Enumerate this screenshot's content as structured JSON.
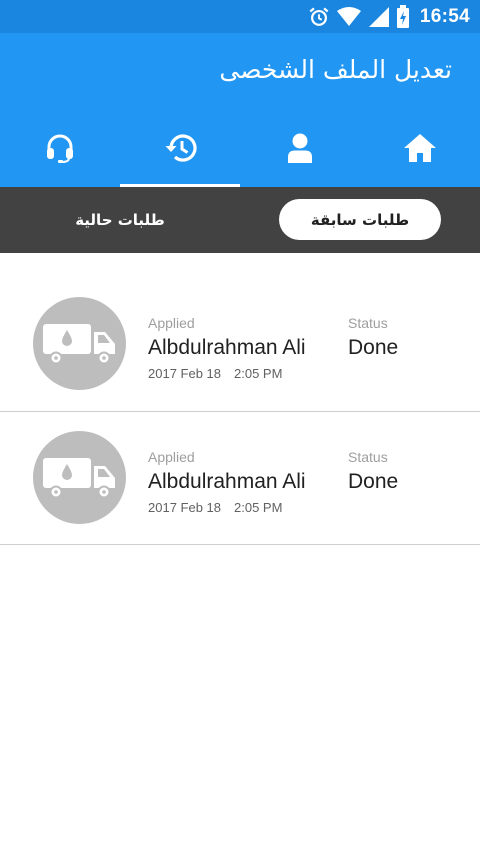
{
  "status_bar": {
    "time": "16:54",
    "icons": [
      "alarm-icon",
      "wifi-icon",
      "signal-icon",
      "battery-icon"
    ]
  },
  "app_bar": {
    "title": "تعديل الملف الشخصى",
    "color": "#2196f3",
    "tabs": [
      {
        "icon": "headset-icon",
        "selected": false
      },
      {
        "icon": "history-icon",
        "selected": true
      },
      {
        "icon": "person-icon",
        "selected": false
      },
      {
        "icon": "home-icon",
        "selected": false
      }
    ]
  },
  "segments": {
    "current_label": "طلبات حالية",
    "previous_label": "طلبات سابقة",
    "selected": "previous"
  },
  "orders": [
    {
      "icon": "water-truck-icon",
      "applied_label": "Applied",
      "name": "Albdulrahman Ali",
      "date": "2017 Feb 18",
      "time": "2:05 PM",
      "status_label": "Status",
      "status": "Done"
    },
    {
      "icon": "water-truck-icon",
      "applied_label": "Applied",
      "name": "Albdulrahman Ali",
      "date": "2017 Feb 18",
      "time": "2:05 PM",
      "status_label": "Status",
      "status": "Done"
    }
  ]
}
